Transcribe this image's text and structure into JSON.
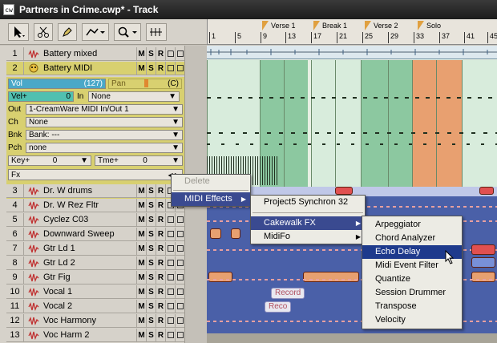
{
  "window": {
    "title": "Partners in Crime.cwp* - Track",
    "icon": "cakewalk-icon"
  },
  "toolbar": {
    "zoom_label": "Q"
  },
  "timeline": {
    "markers": [
      {
        "label": "Verse 1"
      },
      {
        "label": "Break 1"
      },
      {
        "label": "Verse 2"
      },
      {
        "label": "Solo"
      }
    ],
    "measures": [
      "1",
      "5",
      "9",
      "13",
      "17",
      "21",
      "25",
      "29",
      "33",
      "37",
      "41",
      "45"
    ]
  },
  "tracks": [
    {
      "num": "1",
      "name": "Battery mixed"
    },
    {
      "num": "2",
      "name": "Battery MIDI"
    },
    {
      "num": "3",
      "name": "Dr. W drums"
    },
    {
      "num": "4",
      "name": "Dr. W Rez Fltr"
    },
    {
      "num": "5",
      "name": "Cyclez C03"
    },
    {
      "num": "6",
      "name": "Downward Sweep"
    },
    {
      "num": "7",
      "name": "Gtr Ld 1"
    },
    {
      "num": "8",
      "name": "Gtr Ld 2"
    },
    {
      "num": "9",
      "name": "Gtr Fig"
    },
    {
      "num": "10",
      "name": "Vocal 1"
    },
    {
      "num": "11",
      "name": "Vocal 2"
    },
    {
      "num": "12",
      "name": "Voc Harmony"
    },
    {
      "num": "13",
      "name": "Voc Harm 2"
    }
  ],
  "track_buttons": {
    "mute": "M",
    "solo": "S",
    "record": "R"
  },
  "inspector": {
    "vol_label": "Vol",
    "vol_value": "(127)",
    "pan_label": "Pan",
    "pan_value": "(C)",
    "velp_label": "Vel+",
    "velp_value": "0",
    "in_label": "In",
    "in_value": "None",
    "out_label": "Out",
    "out_value": "1-CreamWare MIDI In/Out 1",
    "ch_label": "Ch",
    "ch_value": "None",
    "bnk_label": "Bnk",
    "bnk_value": "Bank: ---",
    "pch_label": "Pch",
    "pch_value": "none",
    "key_label": "Key+",
    "key_value": "0",
    "tme_label": "Tme+",
    "tme_value": "0",
    "fx_label": "Fx"
  },
  "clips": {
    "record1": "Record",
    "record2": "Reco"
  },
  "menus": {
    "fx_menu": [
      "Delete",
      "MIDI Effects"
    ],
    "midi_effects_menu": [
      "Project5 Synchron 32",
      "Cakewalk FX",
      "MidiFo"
    ],
    "cakewalk_fx_menu": [
      "Arpeggiator",
      "Chord Analyzer",
      "Echo Delay",
      "Midi Event Filter",
      "Quantize",
      "Session Drummer",
      "Transpose",
      "Velocity"
    ]
  },
  "colors": {
    "selected_track": "#d8d070",
    "menu_highlight": "#1e3a8c",
    "section_green": "#8cc8a0",
    "section_orange": "#e8a070"
  }
}
